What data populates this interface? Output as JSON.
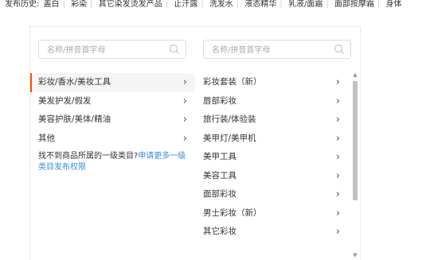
{
  "history": {
    "label": "发布历史:",
    "items": [
      "盖白",
      "彩染",
      "其它染发烫发产品",
      "止汗露",
      "洗发水",
      "液态精华",
      "乳液/面霜",
      "面部按摩霜",
      "身体"
    ]
  },
  "column1": {
    "search_placeholder": "名称/拼音首字母",
    "items": [
      {
        "label": "彩妆/香水/美妆工具",
        "active": true
      },
      {
        "label": "美发护发/假发"
      },
      {
        "label": "美容护肤/美体/精油"
      },
      {
        "label": "其他"
      }
    ],
    "hint_text": "找不到商品所属的一级类目?",
    "hint_link": "申请更多一级类目发布权限"
  },
  "column2": {
    "search_placeholder": "名称/拼音首字母",
    "items": [
      {
        "label": "彩妆套装（新）"
      },
      {
        "label": "唇部彩妆"
      },
      {
        "label": "旅行装/体验装"
      },
      {
        "label": "美甲灯/美甲机"
      },
      {
        "label": "美甲工具"
      },
      {
        "label": "美容工具"
      },
      {
        "label": "面部彩妆"
      },
      {
        "label": "男士彩妆（新）"
      },
      {
        "label": "其它彩妆"
      }
    ]
  },
  "icons": {
    "search": "search-icon",
    "arrow": "chevron-right-icon"
  },
  "colors": {
    "active_border": "#ff4d00",
    "link": "#3b8ed8"
  }
}
